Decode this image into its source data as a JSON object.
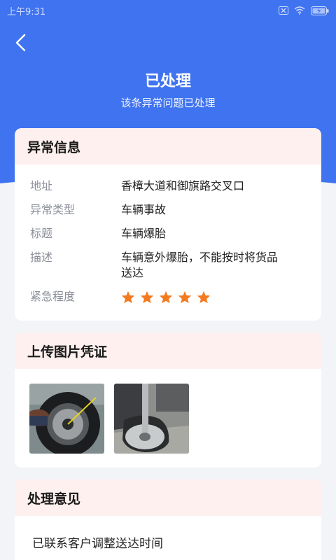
{
  "status_bar": {
    "time": "上午9:31"
  },
  "header": {
    "title": "已处理",
    "subtitle": "该条异常问题已处理"
  },
  "abnormal_info": {
    "title": "异常信息",
    "rows": [
      {
        "label": "地址",
        "value": "香樟大道和御旗路交叉口"
      },
      {
        "label": "异常类型",
        "value": "车辆事故"
      },
      {
        "label": "标题",
        "value": "车辆爆胎"
      },
      {
        "label": "描述",
        "value": "车辆意外爆胎，不能按时将货品送达"
      },
      {
        "label": "紧急程度"
      }
    ],
    "urgency": 5,
    "star_color": "#f47a20"
  },
  "photos": {
    "title": "上传图片凭证"
  },
  "opinion": {
    "title": "处理意见",
    "text": "已联系客户调整送达时间"
  },
  "colors": {
    "primary": "#3f73f0",
    "card_header": "#fef0ef"
  }
}
